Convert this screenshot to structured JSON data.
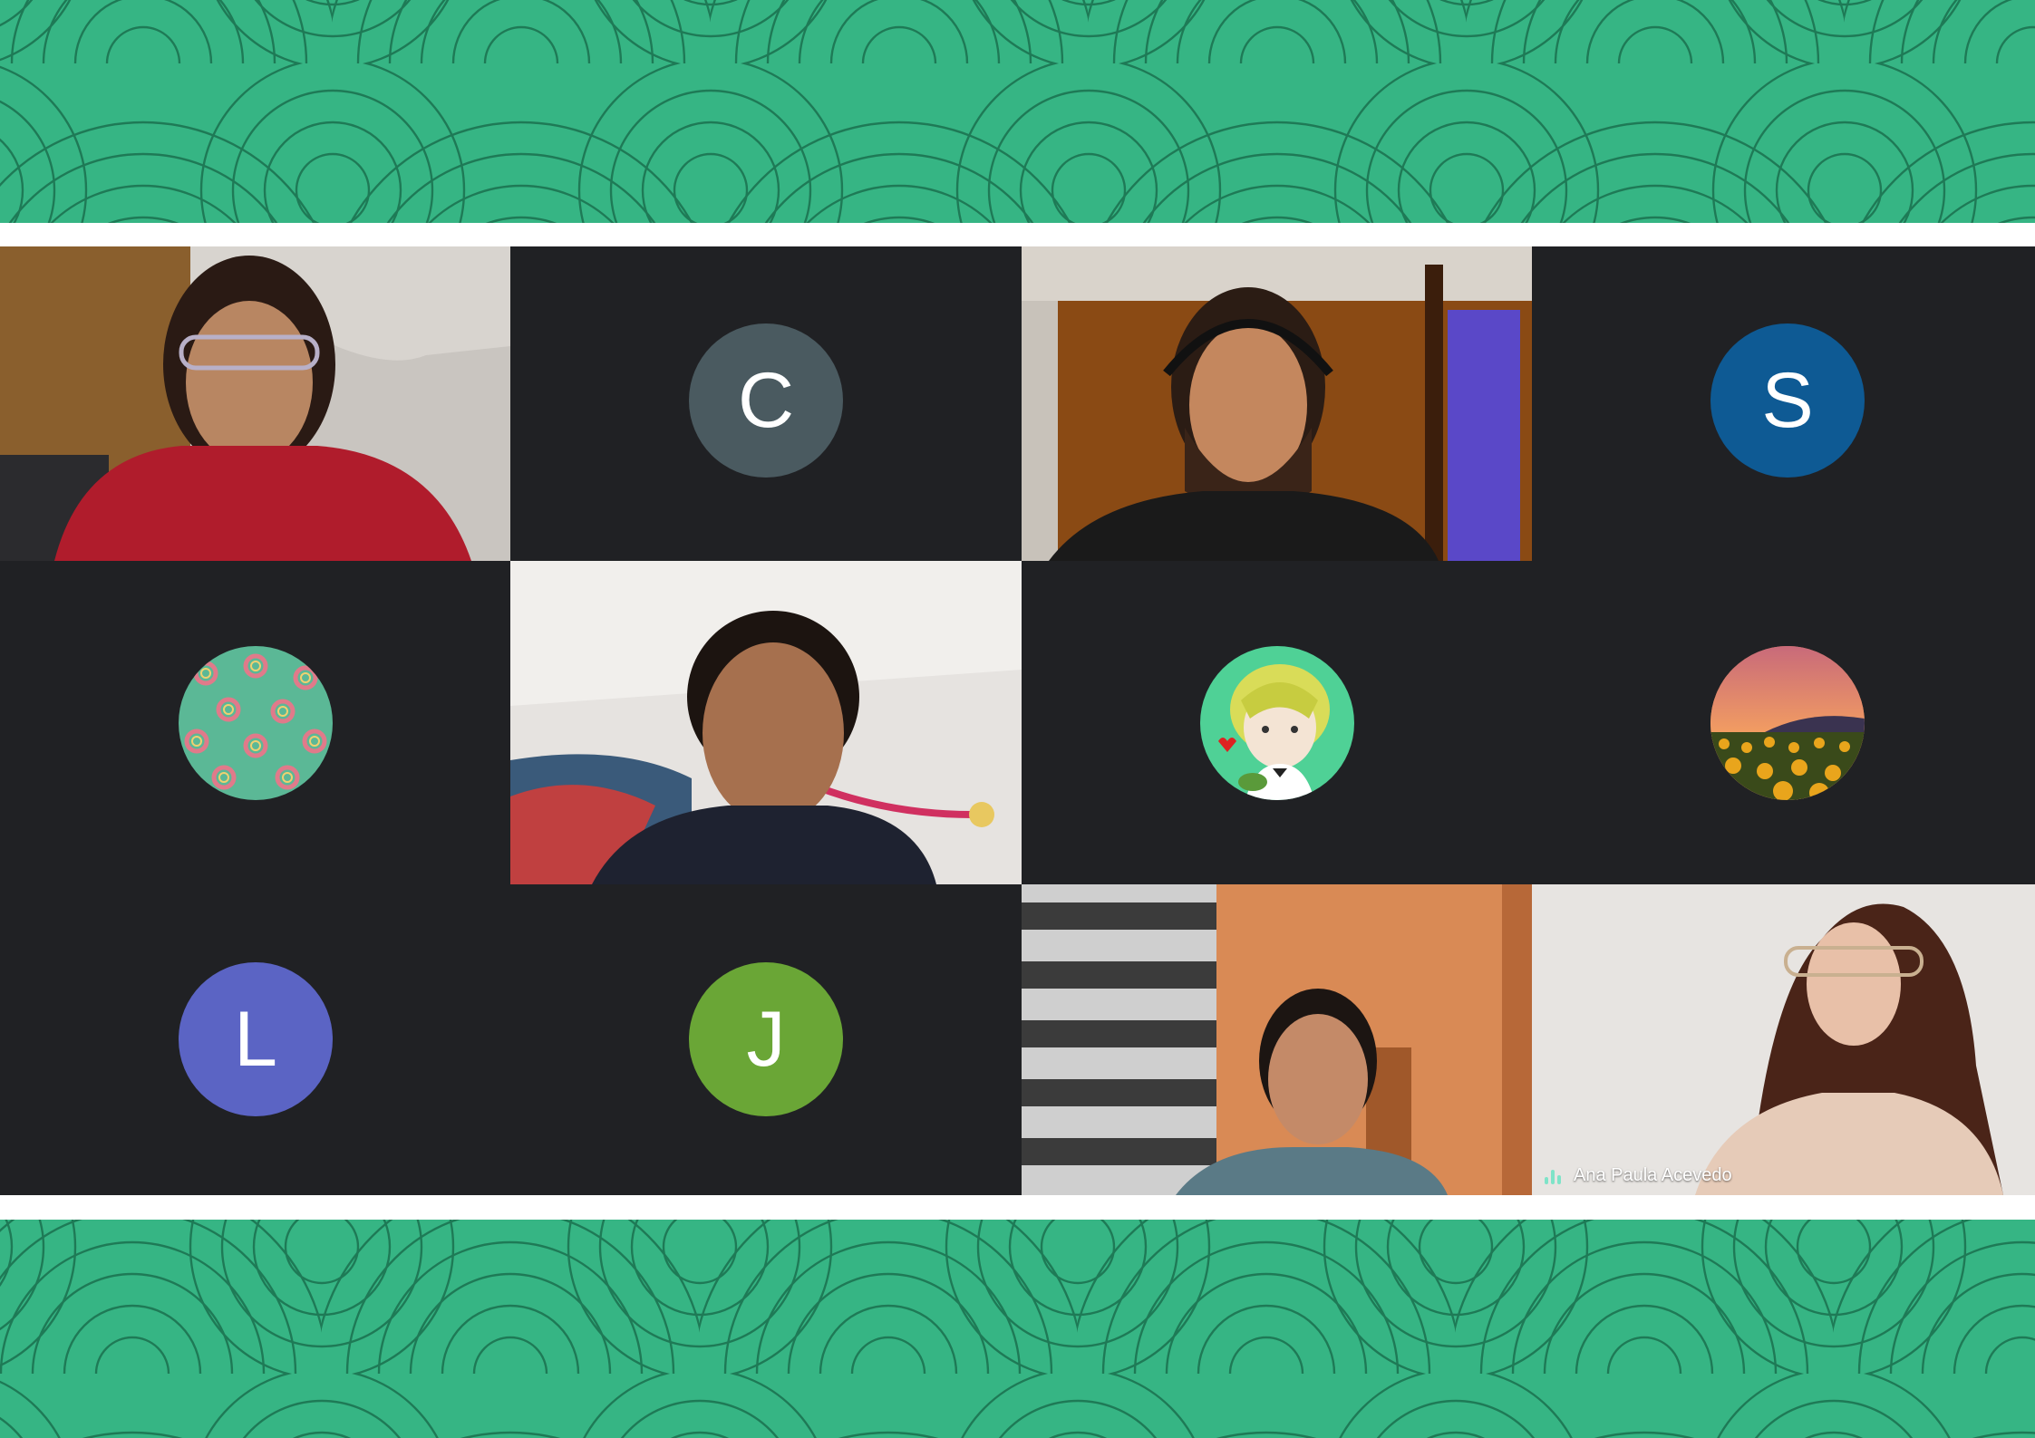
{
  "participants": [
    {
      "type": "video",
      "label": "participant-video-1"
    },
    {
      "type": "avatar",
      "initial": "C",
      "color": "#4a5a60"
    },
    {
      "type": "video",
      "label": "participant-video-2"
    },
    {
      "type": "avatar",
      "initial": "S",
      "color": "#0e5a94"
    },
    {
      "type": "avatar-image",
      "icon": "donut-pattern-avatar"
    },
    {
      "type": "video",
      "label": "participant-video-3"
    },
    {
      "type": "avatar-image",
      "icon": "anime-character-avatar"
    },
    {
      "type": "avatar-image",
      "icon": "sunflower-field-avatar"
    },
    {
      "type": "avatar",
      "initial": "L",
      "color": "#5b64c4"
    },
    {
      "type": "avatar",
      "initial": "J",
      "color": "#6aa636"
    },
    {
      "type": "video",
      "label": "participant-video-4"
    },
    {
      "type": "video",
      "label": "participant-video-5",
      "name": "Ana Paula Acevedo",
      "speaking": true
    }
  ],
  "colors": {
    "banner": "#36b584",
    "banner_lines": "#1e7a56",
    "grid_background": "#202124",
    "speaking_indicator": "#7fe3c8"
  }
}
